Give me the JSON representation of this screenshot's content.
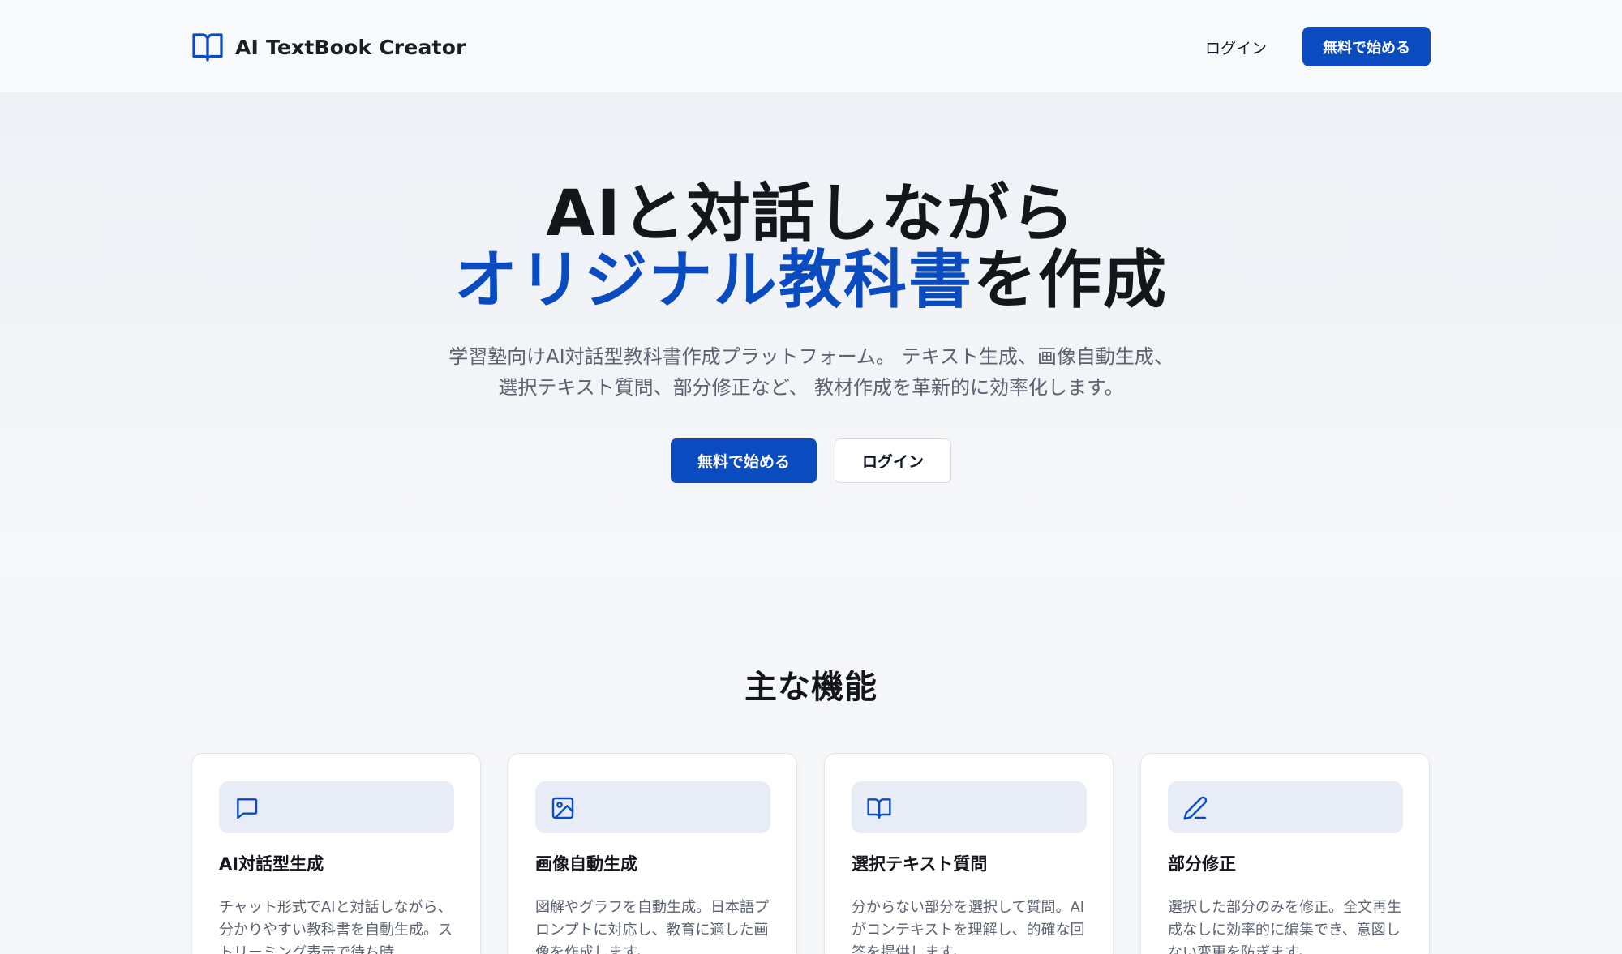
{
  "header": {
    "brand_name": "AI TextBook Creator",
    "brand_icon": "open-book-icon",
    "login_label": "ログイン",
    "cta_label": "無料で始める"
  },
  "hero": {
    "title_line1": "AIと対話しながら",
    "title_line2_accent": "オリジナル教科書",
    "title_line2_rest": "を作成",
    "subtitle_line1": "学習塾向けAI対話型教科書作成プラットフォーム。 テキスト生成、画像自動生成、",
    "subtitle_line2": "選択テキスト質問、部分修正など、 教材作成を革新的に効率化します。",
    "primary_button": "無料で始める",
    "secondary_button": "ログイン"
  },
  "features": {
    "title": "主な機能",
    "cards": [
      {
        "icon": "chat-bubble-icon",
        "title": "AI対話型生成",
        "description": "チャット形式でAIと対話しながら、分かりやすい教科書を自動生成。ストリーミング表示で待ち時"
      },
      {
        "icon": "image-icon",
        "title": "画像自動生成",
        "description": "図解やグラフを自動生成。日本語プロンプトに対応し、教育に適した画像を作成します。"
      },
      {
        "icon": "open-book-icon",
        "title": "選択テキスト質問",
        "description": "分からない部分を選択して質問。AIがコンテキストを理解し、的確な回答を提供します。"
      },
      {
        "icon": "pencil-icon",
        "title": "部分修正",
        "description": "選択した部分のみを修正。全文再生成なしに効率的に編集でき、意図しない変更を防ぎます。"
      }
    ]
  },
  "colors": {
    "accent": "#0a4cc0",
    "icon_bg": "#e8ecf6",
    "text_muted": "#5b6270"
  }
}
